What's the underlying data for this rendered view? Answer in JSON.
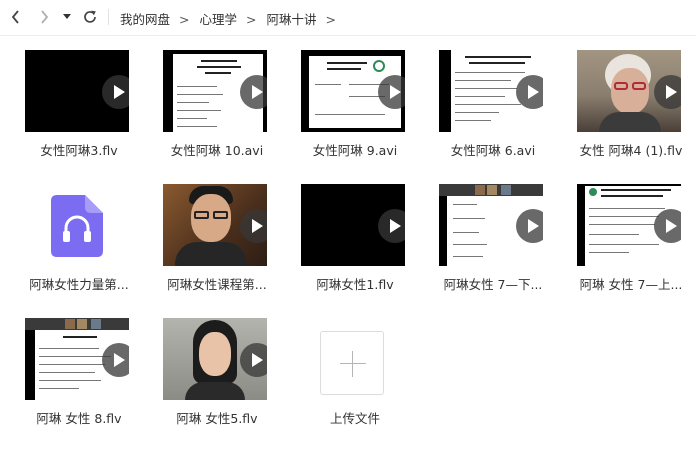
{
  "breadcrumb": [
    "我的网盘",
    "心理学",
    "阿琳十讲"
  ],
  "breadcrumb_separator": ">",
  "nav": {
    "back_icon": "chevron-left-icon",
    "forward_icon": "chevron-right-icon",
    "history_icon": "caret-down-icon",
    "refresh_icon": "refresh-icon"
  },
  "files": [
    {
      "name": "女性阿琳3.flv",
      "thumbnail": "black-video"
    },
    {
      "name": "女性阿琳 10.avi",
      "thumbnail": "document-slide"
    },
    {
      "name": "女性阿琳 9.avi",
      "thumbnail": "document-slide-logo"
    },
    {
      "name": "女性阿琳 6.avi",
      "thumbnail": "document-slide"
    },
    {
      "name": "女性 阿琳4 (1).flv",
      "thumbnail": "elderly-woman-webcam"
    },
    {
      "name": "阿琳女性力量第...",
      "thumbnail": "audio-file"
    },
    {
      "name": "阿琳女性课程第...",
      "thumbnail": "man-webcam"
    },
    {
      "name": "阿琳女性1.flv",
      "thumbnail": "black-video"
    },
    {
      "name": "阿琳女性    7—下...",
      "thumbnail": "video-conference"
    },
    {
      "name": "阿琳 女性 7—上...",
      "thumbnail": "document-slide-logo"
    },
    {
      "name": "阿琳 女性   8.flv",
      "thumbnail": "video-conference"
    },
    {
      "name": "阿琳   女性5.flv",
      "thumbnail": "woman-webcam"
    }
  ],
  "upload": {
    "label": "上传文件",
    "icon": "plus-icon"
  },
  "colors": {
    "audio_icon": "#7b6cf2",
    "play_button": "#3a3a3a"
  }
}
